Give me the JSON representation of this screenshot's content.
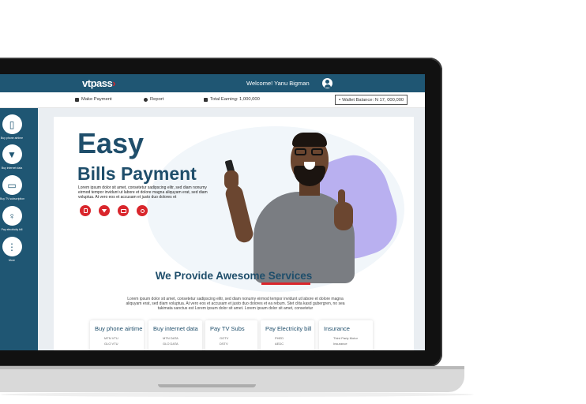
{
  "topbar": {
    "logo_prefix": "vt",
    "logo_suffix": "pass",
    "welcome": "Welcome! Yanu Bigman"
  },
  "subbar": {
    "make_payment": "Make Payment",
    "report": "Report",
    "total_earning": "Total Earning: 1,000,000",
    "wallet_balance": "Wallet Balance: N 17, 000,000"
  },
  "sidebar": {
    "items": [
      {
        "label": "Buy phone airtime",
        "icon": "phone-icon"
      },
      {
        "label": "Buy internet data",
        "icon": "wifi-icon"
      },
      {
        "label": "Buy TV subscription",
        "icon": "tv-icon"
      },
      {
        "label": "Pay electricity bill",
        "icon": "bulb-icon"
      },
      {
        "label": "More",
        "icon": "more-icon"
      }
    ]
  },
  "hero": {
    "title_1": "Easy",
    "title_2": "Bills Payment",
    "description": "Lorem ipsum dolor sit amet, consetetur sadipscing elitr, sed diam nonumy eirmod tempor invidunt ut labore et dolore magna aliquyam erat, sed diam voluptua. At vero eos et accusam et justo duo dolores et",
    "quick_icons": [
      "phone-icon",
      "wifi-icon",
      "tv-icon",
      "bulb-icon"
    ]
  },
  "services": {
    "title": "We Provide Awesome Services",
    "description": "Lorem ipsum dolor sit amet, consetetur sadipscing elitr, sed diam nonumy eirmod tempor invidunt ut labore et dolore magna aliquyam erat, sed diam voluptua. At vero eos et accusam et justo duo dolores et ea rebum. Stet clita kasd gubergren, no sea takimata sanctus est Lorem ipsum dolor sit amet. Lorem ipsum dolor sit amet, consetetur",
    "cards": [
      {
        "title": "Buy phone airtime",
        "line1": "MTN VTU",
        "line2": "GLO VTU"
      },
      {
        "title": "Buy internet data",
        "line1": "MTN DATA",
        "line2": "GLO DATA"
      },
      {
        "title": "Pay TV Subs",
        "line1": "GOTV",
        "line2": "DSTV"
      },
      {
        "title": "Pay Electricity bill",
        "line1": "PHED",
        "line2": "AEDC"
      },
      {
        "title": "Insurance",
        "line1": "Third Party Motor",
        "line2": "Insurance"
      }
    ]
  },
  "colors": {
    "brand_blue": "#1f5673",
    "accent_red": "#d9262c",
    "accent_purple": "#b9b0f0"
  }
}
